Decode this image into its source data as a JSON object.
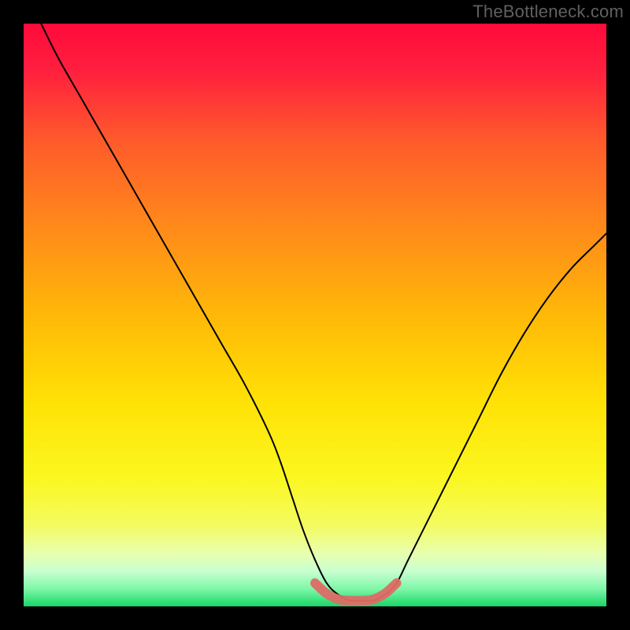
{
  "watermark": "TheBottleneck.com",
  "chart_data": {
    "type": "line",
    "title": "",
    "xlabel": "",
    "ylabel": "",
    "xlim": [
      0,
      100
    ],
    "ylim": [
      0,
      100
    ],
    "grid": false,
    "legend": false,
    "background_gradient": {
      "stops": [
        {
          "pos": 0.0,
          "color": "#ff0a3a"
        },
        {
          "pos": 0.08,
          "color": "#ff1f3e"
        },
        {
          "pos": 0.2,
          "color": "#ff5a2b"
        },
        {
          "pos": 0.35,
          "color": "#ff8a1a"
        },
        {
          "pos": 0.5,
          "color": "#ffb808"
        },
        {
          "pos": 0.65,
          "color": "#ffe205"
        },
        {
          "pos": 0.78,
          "color": "#fbf720"
        },
        {
          "pos": 0.86,
          "color": "#f4fb60"
        },
        {
          "pos": 0.91,
          "color": "#e8ffb0"
        },
        {
          "pos": 0.94,
          "color": "#c8ffd0"
        },
        {
          "pos": 0.97,
          "color": "#7ef7a8"
        },
        {
          "pos": 1.0,
          "color": "#18d668"
        }
      ]
    },
    "series": [
      {
        "name": "bottleneck-curve",
        "color": "#000000",
        "width": 2,
        "x": [
          3,
          6,
          10,
          14,
          18,
          22,
          26,
          30,
          34,
          38,
          42,
          44,
          46,
          48,
          50,
          52,
          54,
          56,
          58,
          60,
          62,
          64,
          66,
          70,
          74,
          78,
          82,
          86,
          90,
          94,
          98,
          100
        ],
        "y": [
          100,
          94,
          87,
          80,
          73,
          66,
          59,
          52,
          45,
          38,
          30,
          25,
          19,
          13,
          8,
          4,
          2,
          1,
          1,
          1,
          2,
          4,
          8,
          16,
          24,
          32,
          40,
          47,
          53,
          58,
          62,
          64
        ]
      },
      {
        "name": "optimal-region-highlight",
        "color": "#dd6b65",
        "width": 12,
        "x": [
          50,
          52,
          54,
          56,
          58,
          60,
          62,
          64
        ],
        "y": [
          4,
          2.2,
          1.2,
          1,
          1,
          1.2,
          2.2,
          4
        ]
      }
    ]
  }
}
